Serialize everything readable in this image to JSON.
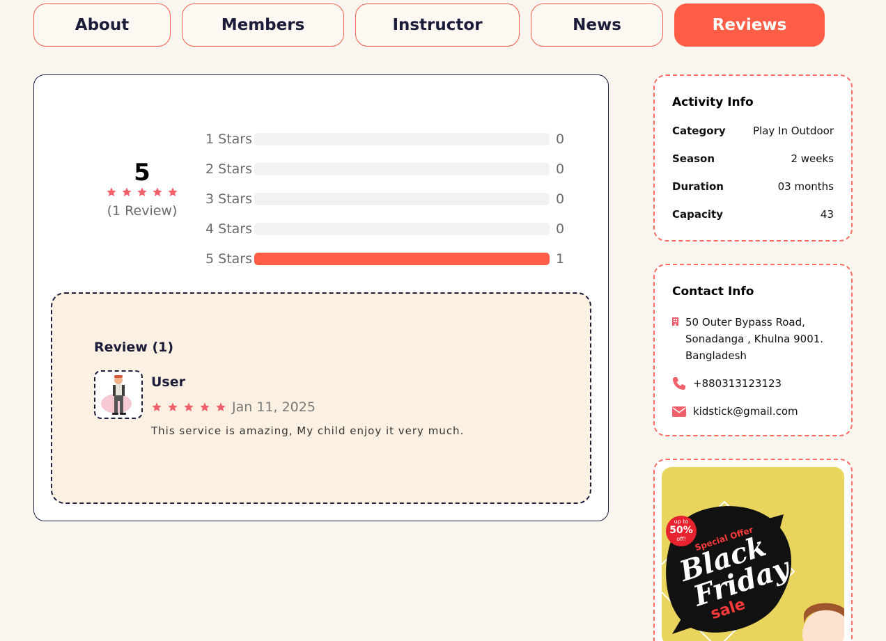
{
  "tabs": [
    {
      "label": "About",
      "active": false
    },
    {
      "label": "Members",
      "active": false
    },
    {
      "label": "Instructor",
      "active": false
    },
    {
      "label": "News",
      "active": false
    },
    {
      "label": "Reviews",
      "active": true
    }
  ],
  "rating": {
    "average": "5",
    "stars": 5,
    "count_label": "(1 Review)",
    "breakdown": [
      {
        "label": "1 Stars",
        "count": "0",
        "fraction": 0
      },
      {
        "label": "2 Stars",
        "count": "0",
        "fraction": 0
      },
      {
        "label": "3 Stars",
        "count": "0",
        "fraction": 0
      },
      {
        "label": "4 Stars",
        "count": "0",
        "fraction": 0
      },
      {
        "label": "5 Stars",
        "count": "1",
        "fraction": 1
      }
    ]
  },
  "reviews": {
    "heading": "Review (1)",
    "items": [
      {
        "name": "User",
        "stars": 5,
        "date": "Jan 11, 2025",
        "text": "This service is amazing, My child enjoy it very much."
      }
    ]
  },
  "activity_info": {
    "title": "Activity Info",
    "rows": [
      {
        "key": "Category",
        "value": "Play In Outdoor"
      },
      {
        "key": "Season",
        "value": "2 weeks"
      },
      {
        "key": "Duration",
        "value": "03 months"
      },
      {
        "key": "Capacity",
        "value": "43"
      }
    ]
  },
  "contact_info": {
    "title": "Contact Info",
    "address_lines": [
      "50 Outer Bypass Road,",
      "Sonadanga , Khulna 9001.",
      "Bangladesh"
    ],
    "phone": "+880313123123",
    "email": "kidstick@gmail.com"
  },
  "promo": {
    "badge_top": "up to",
    "badge_pct": "50%",
    "badge_bottom": "off!",
    "tagline": "Special Offer",
    "title_1": "Black",
    "title_2": "Friday",
    "title_3": "sale"
  },
  "colors": {
    "accent": "#ff5d45",
    "dark": "#1b1b3a",
    "star": "#f0606a",
    "page_bg": "#faf5ee"
  }
}
